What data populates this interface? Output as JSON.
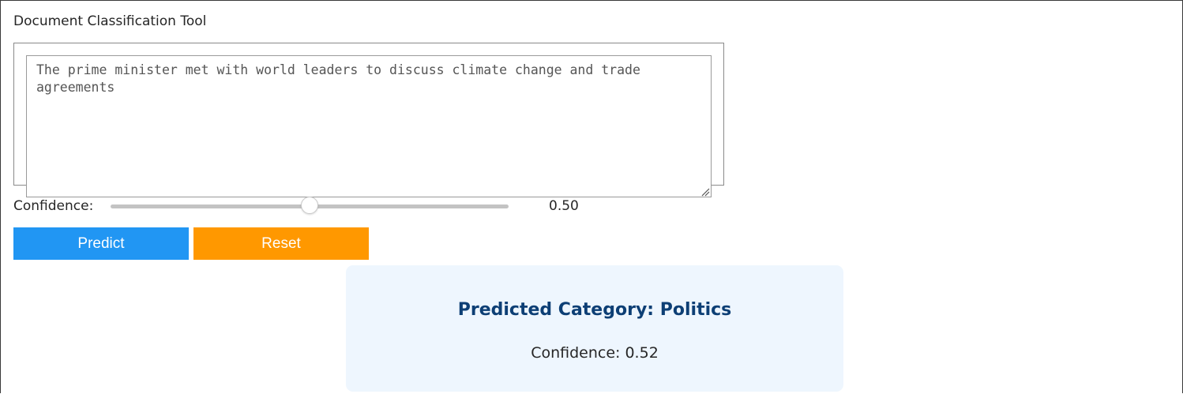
{
  "app": {
    "title": "Document Classification Tool"
  },
  "input": {
    "text": "The prime minister met with world leaders to discuss climate change and trade agreements"
  },
  "confidence_control": {
    "label": "Confidence:",
    "value": 0.5,
    "value_text": "0.50"
  },
  "buttons": {
    "predict_label": "Predict",
    "reset_label": "Reset",
    "predict_color": "#2196f3",
    "reset_color": "#ff9800"
  },
  "result": {
    "title": "Predicted Category: Politics",
    "confidence_text": "Confidence: 0.52",
    "title_color": "#0d3f75",
    "background": "#eef6fe"
  }
}
